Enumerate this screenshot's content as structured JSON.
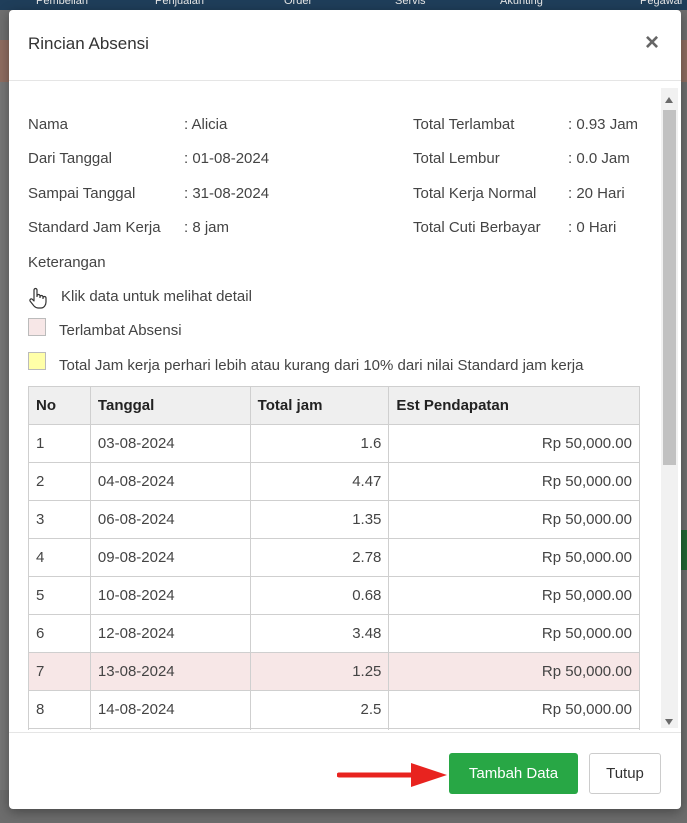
{
  "background": {
    "menu": [
      "Pembelian",
      "Penjualan",
      "Order",
      "Servis",
      "Akunting",
      "Pegawai"
    ]
  },
  "modal": {
    "title": "Rincian Absensi",
    "close_symbol": "×",
    "info_left": [
      {
        "label": "Nama",
        "value": ": Alicia"
      },
      {
        "label": "Dari Tanggal",
        "value": ": 01-08-2024"
      },
      {
        "label": "Sampai Tanggal",
        "value": ": 31-08-2024"
      },
      {
        "label": "Standard Jam Kerja",
        "value": ": 8 jam"
      }
    ],
    "info_right": [
      {
        "label": "Total Terlambat",
        "value": ": 0.93 Jam"
      },
      {
        "label": "Total Lembur",
        "value": ": 0.0 Jam"
      },
      {
        "label": "Total Kerja Normal",
        "value": ": 20 Hari"
      },
      {
        "label": "Total Cuti Berbayar",
        "value": ": 0 Hari"
      }
    ],
    "keterangan_label": "Keterangan",
    "legend": {
      "click_hint": "Klik data untuk melihat detail",
      "late": "Terlambat Absensi",
      "late_color": "#f7e7e7",
      "deviation": "Total Jam kerja perhari lebih atau kurang dari 10% dari nilai Standard jam kerja",
      "deviation_color": "#ffffa8"
    },
    "table": {
      "headers": [
        "No",
        "Tanggal",
        "Total jam",
        "Est Pendapatan"
      ],
      "rows": [
        {
          "no": "1",
          "tanggal": "03-08-2024",
          "total_jam": "1.6",
          "est": "Rp 50,000.00",
          "late": false
        },
        {
          "no": "2",
          "tanggal": "04-08-2024",
          "total_jam": "4.47",
          "est": "Rp 50,000.00",
          "late": false
        },
        {
          "no": "3",
          "tanggal": "06-08-2024",
          "total_jam": "1.35",
          "est": "Rp 50,000.00",
          "late": false
        },
        {
          "no": "4",
          "tanggal": "09-08-2024",
          "total_jam": "2.78",
          "est": "Rp 50,000.00",
          "late": false
        },
        {
          "no": "5",
          "tanggal": "10-08-2024",
          "total_jam": "0.68",
          "est": "Rp 50,000.00",
          "late": false
        },
        {
          "no": "6",
          "tanggal": "12-08-2024",
          "total_jam": "3.48",
          "est": "Rp 50,000.00",
          "late": false
        },
        {
          "no": "7",
          "tanggal": "13-08-2024",
          "total_jam": "1.25",
          "est": "Rp 50,000.00",
          "late": true
        },
        {
          "no": "8",
          "tanggal": "14-08-2024",
          "total_jam": "2.5",
          "est": "Rp 50,000.00",
          "late": false
        },
        {
          "no": "",
          "tanggal": "",
          "total_jam": "",
          "est": "",
          "late": false
        }
      ]
    },
    "footer": {
      "tambah_label": "Tambah Data",
      "tutup_label": "Tutup",
      "arrow_color": "#e8231f"
    }
  }
}
